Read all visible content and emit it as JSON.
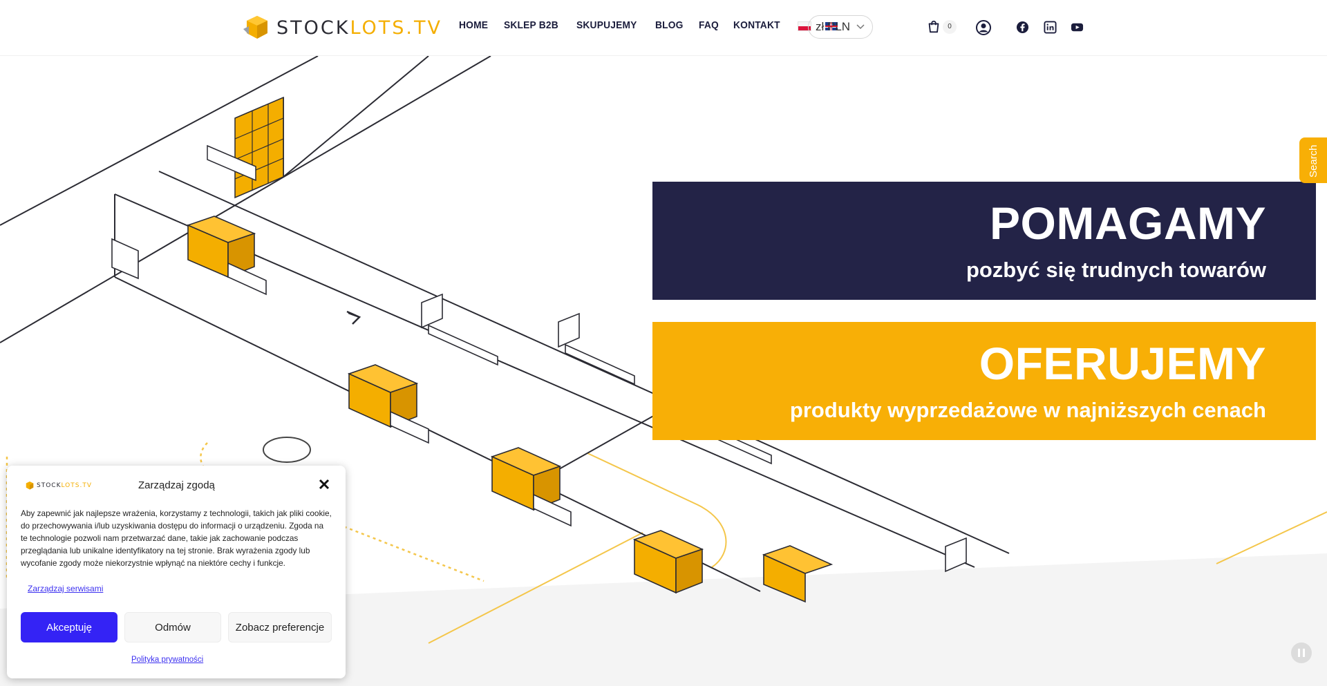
{
  "header": {
    "logo": {
      "part1": "STOCK",
      "part2": "LOTS.TV"
    },
    "nav": [
      {
        "label": "HOME"
      },
      {
        "label": "SKLEP B2B"
      },
      {
        "label": "SKUPUJEMY"
      },
      {
        "label": "BLOG"
      },
      {
        "label": "FAQ"
      },
      {
        "label": "KONTAKT"
      }
    ],
    "flags": [
      "flag-pl-icon",
      "flag-gb-icon"
    ],
    "currency": {
      "selected": "zł PLN"
    },
    "cart": {
      "count": "0",
      "icon": "cart-icon"
    },
    "account_icon": "user-icon",
    "social_icons": [
      "facebook-icon",
      "linkedin-icon",
      "youtube-icon"
    ]
  },
  "hero": {
    "banner1": {
      "title": "POMAGAMY",
      "subtitle": "pozbyć się trudnych towarów",
      "bg_color": "#232347"
    },
    "banner2": {
      "title": "OFERUJEMY",
      "subtitle": "produkty wyprzedażowe w najniższych cenach",
      "bg_color": "#f8af06"
    },
    "search_tab": "Search",
    "pause_icon": "pause-icon"
  },
  "consent": {
    "logo": {
      "part1": "STOCK",
      "part2": "LOTS.TV"
    },
    "title": "Zarządzaj zgodą",
    "body": "Aby zapewnić jak najlepsze wrażenia, korzystamy z technologii, takich jak pliki cookie, do przechowywania i/lub uzyskiwania dostępu do informacji o urządzeniu. Zgoda na te technologie pozwoli nam przetwarzać dane, takie jak zachowanie podczas przeglądania lub unikalne identyfikatory na tej stronie. Brak wyrażenia zgody lub wycofanie zgody może niekorzystnie wpłynąć na niektóre cechy i funkcje.",
    "manage_services": "Zarządzaj serwisami",
    "accept": "Akceptuję",
    "deny": "Odmów",
    "preferences": "Zobacz preferencje",
    "privacy": "Polityka prywatności",
    "accent_color": "#3423f5"
  }
}
